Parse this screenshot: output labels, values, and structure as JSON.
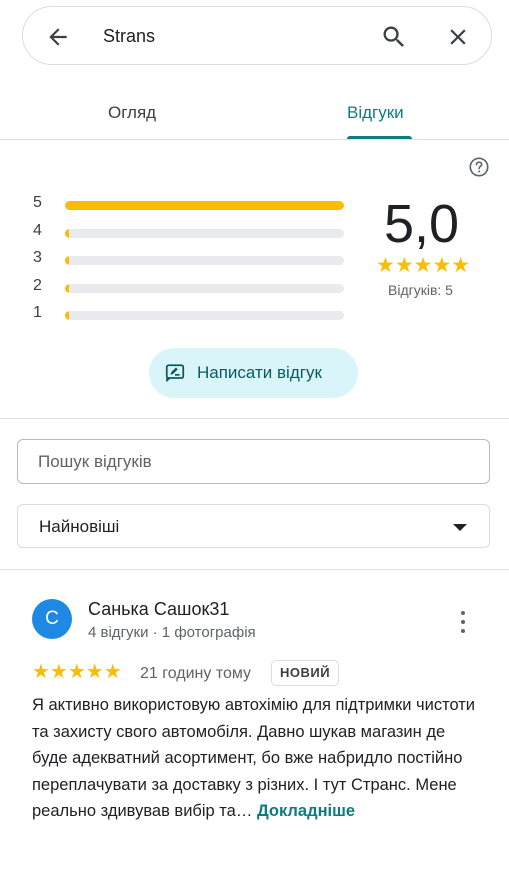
{
  "search": {
    "query": "Strans",
    "back_icon": "arrow-back-icon",
    "search_icon": "search-icon",
    "close_icon": "close-icon"
  },
  "tabs": [
    {
      "label": "Огляд",
      "active": false
    },
    {
      "label": "Відгуки",
      "active": true
    }
  ],
  "colors": {
    "accent": "#0b7d80",
    "star": "#fbbc04",
    "avatar": "#1e88e5",
    "write_button_bg": "#d9f5f9"
  },
  "rating_summary": {
    "help_icon": "help-circle-icon",
    "distribution": [
      {
        "stars": "5",
        "fraction": 1.0
      },
      {
        "stars": "4",
        "fraction": 0.0
      },
      {
        "stars": "3",
        "fraction": 0.0
      },
      {
        "stars": "2",
        "fraction": 0.0
      },
      {
        "stars": "1",
        "fraction": 0.0
      }
    ],
    "average": "5,0",
    "stars": "★★★★★",
    "count_label": "Відгуків: 5"
  },
  "write_review": {
    "label": "Написати відгук",
    "icon": "rate-review-icon"
  },
  "review_search": {
    "placeholder": "Пошук відгуків"
  },
  "sort": {
    "selected": "Найновіші"
  },
  "review": {
    "avatar_letter": "С",
    "author": "Санька Сашок31",
    "meta": "4 відгуки · 1 фотографія",
    "stars": "★★★★★",
    "time": "21 годину тому",
    "badge": "НОВИЙ",
    "text": "Я активно використовую автохімію для підтримки чистоти та захисту свого автомобіля. Давно шукав магазин де буде адекватний асортимент, бо вже набридло постійно переплачувати за доставку з різних. І тут Странс. Мене реально здивував вибір та…",
    "more_label": "Докладніше"
  }
}
